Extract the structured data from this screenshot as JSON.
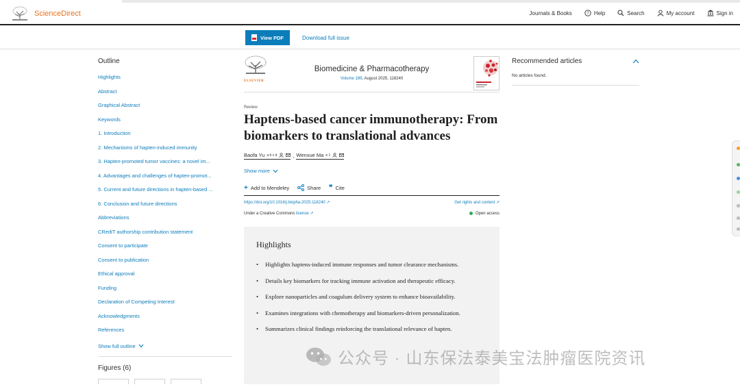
{
  "header": {
    "logo_text": "ScienceDirect",
    "nav": [
      {
        "label": "Journals & Books"
      },
      {
        "label": "Help",
        "icon": "help-icon"
      },
      {
        "label": "Search",
        "icon": "search-icon"
      },
      {
        "label": "My account",
        "icon": "user-icon"
      },
      {
        "label": "Sign in",
        "icon": "institution-icon"
      }
    ]
  },
  "subbar": {
    "view_pdf": "View PDF",
    "download_issue": "Download full issue"
  },
  "outline": {
    "title": "Outline",
    "items": [
      "Highlights",
      "Abstract",
      "Graphical Abstract",
      "Keywords",
      "1. Introduction",
      "2. Mechanisms of hapten-induced immunity",
      "3. Hapten-promoted tumor vaccines: a novel im...",
      "4. Advantages and challenges of hapten-promot...",
      "5. Current and future directions in hapten-based ...",
      "6. Conclusion and future directions",
      "Abbreviations",
      "CRediT authorship contribution statement",
      "Consent to participate",
      "Consent to publication",
      "Ethical approval",
      "Funding",
      "Declaration of Competing Interest",
      "Acknowledgments",
      "References"
    ],
    "show_full": "Show full outline",
    "figures": "Figures (6)"
  },
  "article": {
    "publisher": "ELSEVIER",
    "journal": "Biomedicine & Pharmacotherapy",
    "volume": "Volume 189",
    "volume_rest": ", August 2025, 118240",
    "type": "Review",
    "title": "Haptens-based cancer immunotherapy: From biomarkers to translational advances",
    "authors": [
      {
        "name": "Baofa Yu",
        "sup": "a b c d"
      },
      {
        "name": "Wenxue Ma",
        "sup": "e 1"
      }
    ],
    "author_sep": ",",
    "show_more": "Show more",
    "actions": {
      "mendeley": "Add to Mendeley",
      "share": "Share",
      "cite": "Cite"
    },
    "doi": "https://doi.org/10.1016/j.biopha.2025.118240 ↗",
    "rights": "Get rights and content ↗",
    "license_prefix": "Under a Creative Commons",
    "license_link": "license ↗",
    "open_access": "Open access"
  },
  "highlights": {
    "title": "Highlights",
    "items": [
      "Highlights haptens-induced immune responses and tumor clearance mechanisms.",
      "Details key biomarkers for tracking immune activation and therapeutic efficacy.",
      "Explore nanoparticles and coagulum delivery system to enhance bioavailability.",
      "Examines integrations with chemotherapy and biomarkers-driven personalization.",
      "Summarizes clinical findings reinforcing the translational relevance of hapten."
    ]
  },
  "recommended": {
    "title": "Recommended articles",
    "none": "No articles found."
  },
  "watermark": {
    "text": "公众号 · 山东保法泰美宝法肿瘤医院资讯"
  },
  "colors": {
    "brand_orange": "#e9711c",
    "link_blue": "#0c7dbb",
    "open_access_green": "#2fa84f",
    "highlight_bg": "#f2f2f2"
  }
}
